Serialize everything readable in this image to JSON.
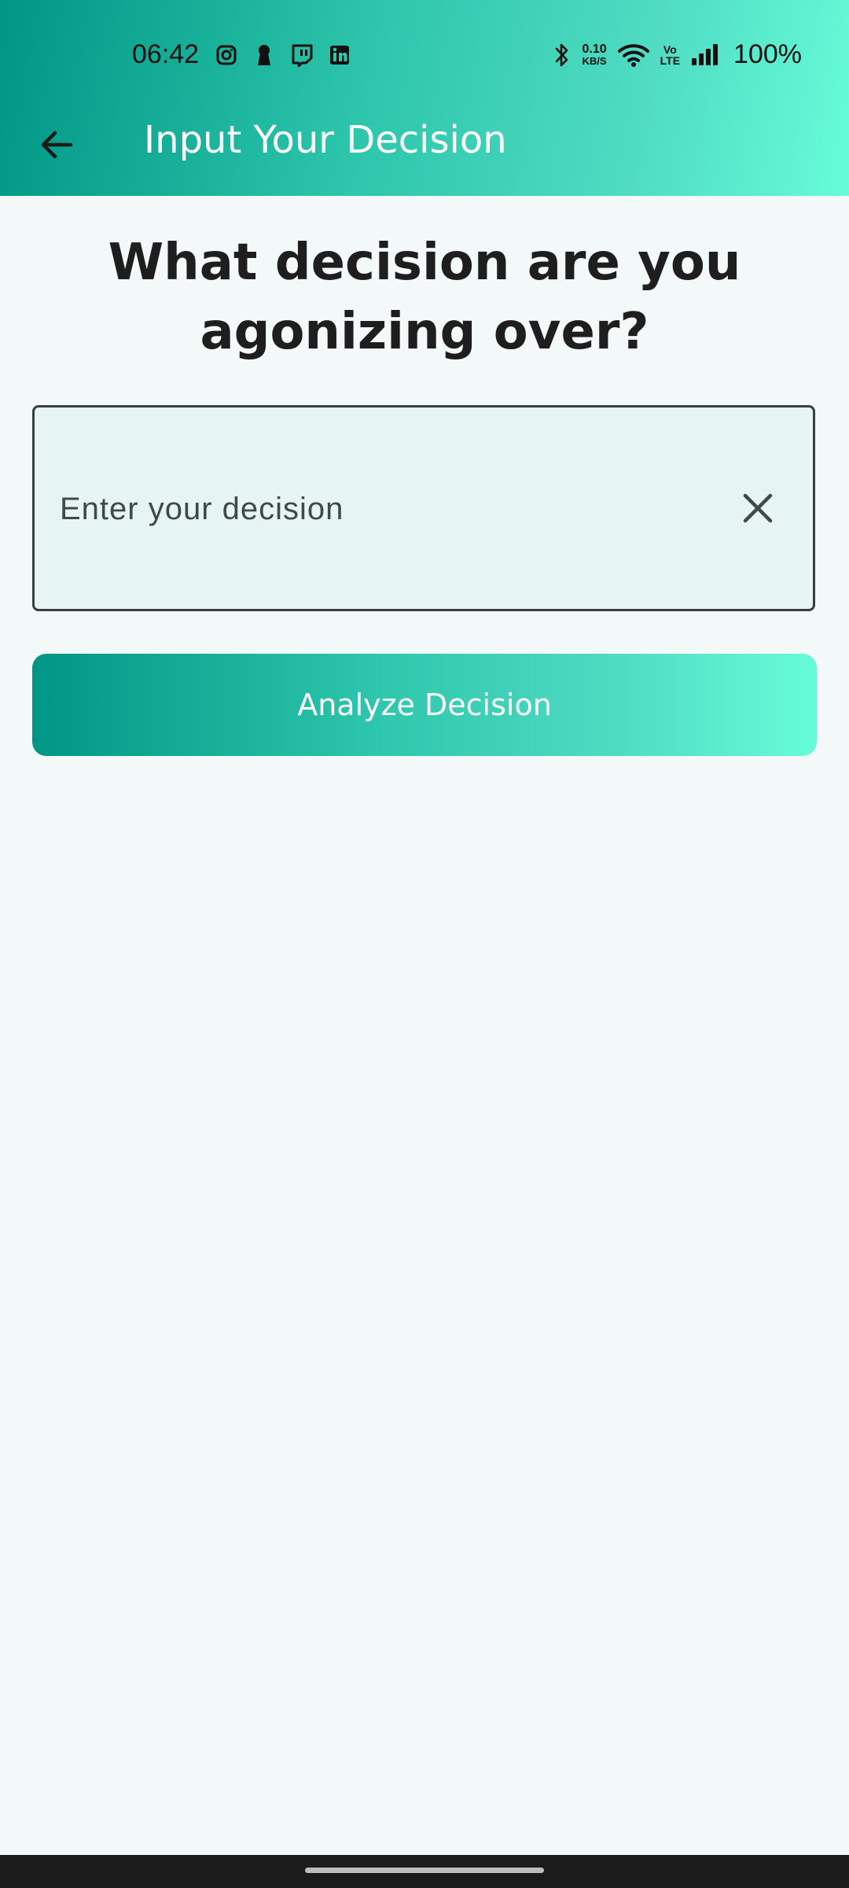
{
  "status_bar": {
    "time": "06:42",
    "left_icons": [
      "instagram-icon",
      "keyhole-icon",
      "twitch-icon",
      "linkedin-icon"
    ],
    "net_speed_value": "0.10",
    "net_speed_unit": "KB/S",
    "volte_top": "Vo",
    "volte_bottom": "LTE",
    "battery": "100%"
  },
  "app_bar": {
    "title": "Input Your Decision",
    "back_icon": "arrow-left-icon"
  },
  "main": {
    "question": "What decision are you agonizing over?",
    "input": {
      "value": "",
      "placeholder": "Enter your decision",
      "clear_icon": "close-icon"
    },
    "analyze_label": "Analyze Decision"
  },
  "colors": {
    "gradient_start": "#009685",
    "gradient_end": "#66fcd9",
    "background": "#f3f9f8",
    "input_background": "#e6f5f2",
    "text_dark": "#1e1e1e"
  }
}
